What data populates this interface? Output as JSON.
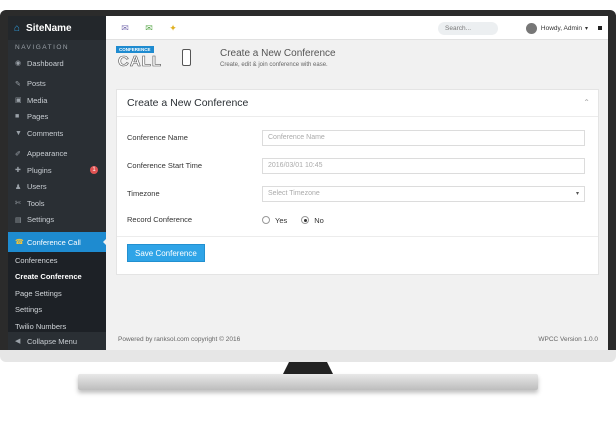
{
  "brand": {
    "name": "SiteName",
    "icon": "house-icon"
  },
  "sidebar": {
    "nav_label": "NAVIGATION",
    "items": [
      {
        "label": "Dashboard",
        "icon": "dashboard-icon"
      },
      {
        "label": "Posts",
        "icon": "pin-icon"
      },
      {
        "label": "Media",
        "icon": "media-icon"
      },
      {
        "label": "Pages",
        "icon": "page-icon"
      },
      {
        "label": "Comments",
        "icon": "comment-icon"
      },
      {
        "label": "Appearance",
        "icon": "brush-icon"
      },
      {
        "label": "Plugins",
        "icon": "plug-icon",
        "badge": "1"
      },
      {
        "label": "Users",
        "icon": "user-icon"
      },
      {
        "label": "Tools",
        "icon": "wrench-icon"
      },
      {
        "label": "Settings",
        "icon": "settings-icon"
      }
    ],
    "active": {
      "label": "Conference Call",
      "icon": "phone-icon"
    },
    "sub_items": [
      {
        "label": "Conferences"
      },
      {
        "label": "Create Conference",
        "current": true
      },
      {
        "label": "Page Settings"
      },
      {
        "label": "Settings"
      },
      {
        "label": "Twilio Numbers"
      }
    ],
    "collapse_label": "Collapse Menu"
  },
  "topbar": {
    "icons": [
      "updates-icon",
      "comments-icon",
      "notify-icon"
    ],
    "search_placeholder": "Search...",
    "greeting": "Howdy, Admin"
  },
  "page_header": {
    "logo_label": "CONFERENCE",
    "logo_text": "CALL",
    "title": "Create a New Conference",
    "subtitle": "Create, edit & join conference with ease."
  },
  "panel": {
    "title": "Create a New Conference",
    "fields": {
      "name_label": "Conference Name",
      "name_placeholder": "Conference Name",
      "start_label": "Conference Start Time",
      "start_value": "2016/03/01  10:45",
      "tz_label": "Timezone",
      "tz_placeholder": "Select Timezone",
      "record_label": "Record Conference",
      "record_yes": "Yes",
      "record_no": "No",
      "record_selected": "No"
    },
    "save_label": "Save Conference"
  },
  "footer": {
    "left": "Powered by ranksol.com copyright © 2016",
    "right": "WPCC Version 1.0.0"
  },
  "colors": {
    "accent": "#2fa4e7",
    "sidebar_bg": "#2a2f34",
    "active_bg": "#1e8bd0",
    "badge": "#e05353"
  }
}
